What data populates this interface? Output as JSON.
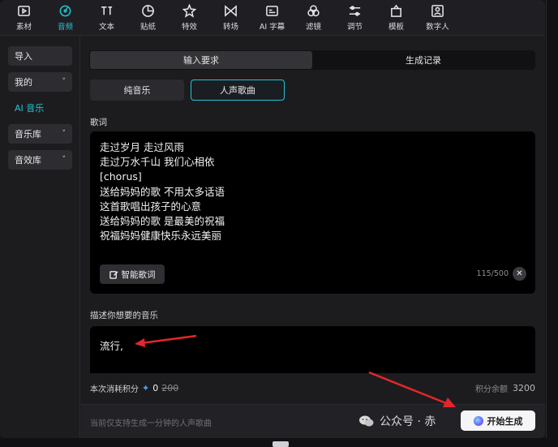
{
  "toolbar": {
    "items": [
      {
        "label": "素材",
        "icon": "media-icon"
      },
      {
        "label": "音频",
        "icon": "audio-icon",
        "active": true
      },
      {
        "label": "文本",
        "icon": "text-icon"
      },
      {
        "label": "贴纸",
        "icon": "sticker-icon"
      },
      {
        "label": "特效",
        "icon": "effects-icon"
      },
      {
        "label": "转场",
        "icon": "transition-icon"
      },
      {
        "label": "AI 字幕",
        "icon": "ai-subtitle-icon"
      },
      {
        "label": "滤镜",
        "icon": "filter-icon"
      },
      {
        "label": "调节",
        "icon": "adjust-icon"
      },
      {
        "label": "模板",
        "icon": "template-icon"
      },
      {
        "label": "数字人",
        "icon": "digital-human-icon"
      }
    ],
    "accent": "#22c5d4"
  },
  "sidebar": {
    "items": [
      {
        "label": "导入",
        "dropdown": false
      },
      {
        "label": "我的",
        "dropdown": true
      },
      {
        "label": "AI 音乐",
        "dropdown": false,
        "active": true
      },
      {
        "label": "音乐库",
        "dropdown": true
      },
      {
        "label": "音效库",
        "dropdown": true
      }
    ]
  },
  "main": {
    "tabs": [
      {
        "label": "输入要求",
        "active": true
      },
      {
        "label": "生成记录",
        "active": false
      }
    ],
    "subtabs": [
      {
        "label": "纯音乐",
        "active": false
      },
      {
        "label": "人声歌曲",
        "active": true
      }
    ],
    "lyrics_label": "歌词",
    "lyrics_lines": [
      "走过岁月 走过风雨",
      "走过万水千山 我们心相依",
      "[chorus]",
      "送给妈妈的歌 不用太多话语",
      "这首歌唱出孩子的心意",
      "送给妈妈的歌 是最美的祝福",
      "祝福妈妈健康快乐永远美丽"
    ],
    "smart_lyrics_label": "智能歌词",
    "char_counter": "115/500",
    "describe_label": "描述你想要的音乐",
    "describe_text": "流行,",
    "cost_label": "本次消耗积分",
    "cost_now": "0",
    "cost_old": "200",
    "balance_label": "积分余额",
    "balance_value": "3200",
    "footer_note": "当前仅支持生成一分钟的人声歌曲",
    "generate_label": "开始生成"
  },
  "watermark": {
    "text": "公众号 · 赤"
  }
}
